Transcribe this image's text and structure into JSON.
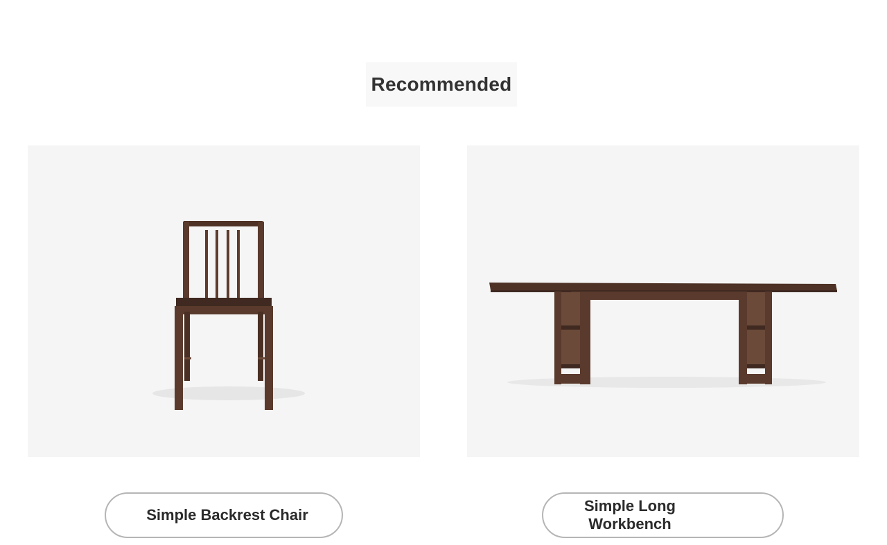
{
  "section": {
    "title": "Recommended"
  },
  "products": [
    {
      "name": "Simple Backrest Chair",
      "image": "walnut-backrest-chair-photo"
    },
    {
      "name": "Simple Long Workbench",
      "image": "walnut-long-workbench-photo"
    }
  ],
  "colors": {
    "wood": "#5a3a2c",
    "wood_dark": "#3f2920",
    "image_bg": "#f5f5f5",
    "button_border": "#b5b5b5",
    "text": "#2b2b2b"
  }
}
